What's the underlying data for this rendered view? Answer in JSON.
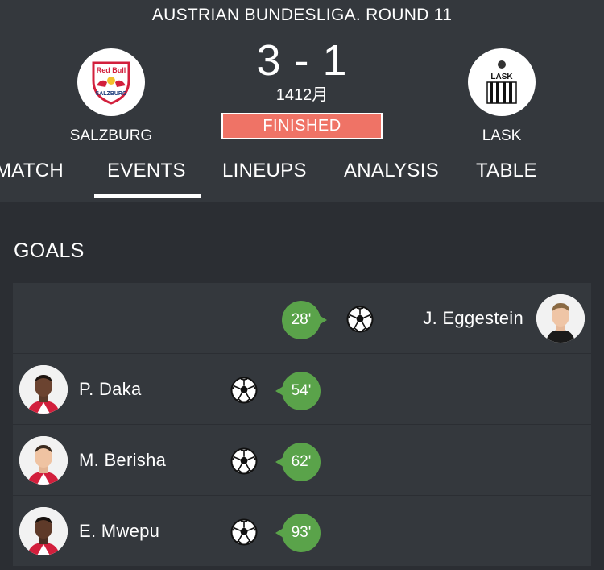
{
  "match": {
    "competition": "AUSTRIAN BUNDESLIGA. ROUND 11",
    "score": "3 - 1",
    "date": "1412月",
    "status": "FINISHED",
    "home_team": "SALZBURG",
    "away_team": "LASK",
    "home_logo_text": "Red Bull",
    "away_logo_text": "LASK"
  },
  "tabs": [
    "MATCH",
    "EVENTS",
    "LINEUPS",
    "ANALYSIS",
    "TABLE"
  ],
  "active_tab": "EVENTS",
  "goals": {
    "title": "GOALS",
    "events": [
      {
        "side": "away",
        "player": "J. Eggestein",
        "minute": "28'",
        "icon": "soccer-ball-icon"
      },
      {
        "side": "home",
        "player": "P. Daka",
        "minute": "54'",
        "icon": "soccer-ball-icon"
      },
      {
        "side": "home",
        "player": "M. Berisha",
        "minute": "62'",
        "icon": "soccer-ball-icon"
      },
      {
        "side": "home",
        "player": "E. Mwepu",
        "minute": "93'",
        "icon": "soccer-ball-icon"
      }
    ]
  },
  "colors": {
    "background": "#2b2e33",
    "panel": "#34383d",
    "status_badge": "#ef7366",
    "minute_badge": "#5aa34a"
  }
}
